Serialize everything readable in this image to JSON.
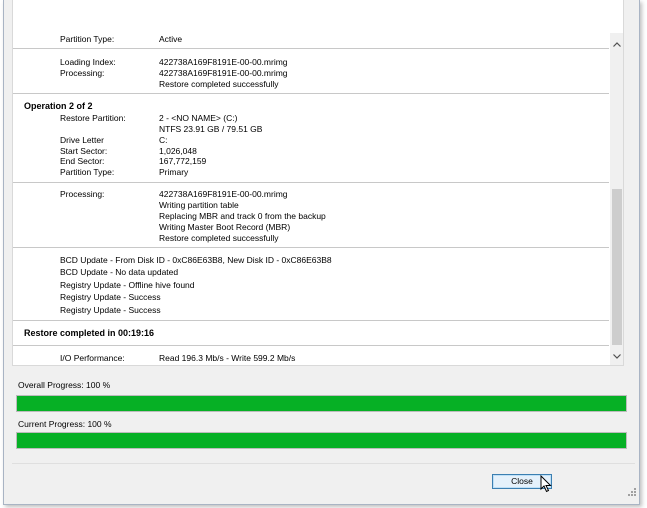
{
  "log": {
    "top_fragment": {
      "label": "Partition Type:",
      "value": "Active"
    },
    "op1_processing": {
      "loading_index_label": "Loading Index:",
      "loading_index_value": "422738A169F8191E-00-00.mrimg",
      "processing_label": "Processing:",
      "processing_lines": [
        "422738A169F8191E-00-00.mrimg",
        "Restore completed successfully"
      ]
    },
    "op2": {
      "heading": "Operation 2 of 2",
      "restore_partition_label": "Restore Partition:",
      "restore_partition_lines": [
        "2 - <NO NAME> (C:)",
        "NTFS 23.91 GB / 79.51 GB"
      ],
      "drive_letter_label": "Drive Letter",
      "drive_letter_value": "C:",
      "start_sector_label": "Start Sector:",
      "start_sector_value": "1,026,048",
      "end_sector_label": "End Sector:",
      "end_sector_value": "167,772,159",
      "partition_type_label": "Partition Type:",
      "partition_type_value": "Primary"
    },
    "op2_processing": {
      "label": "Processing:",
      "lines": [
        "422738A169F8191E-00-00.mrimg",
        "Writing partition table",
        "Replacing MBR and track 0 from the backup",
        "Writing Master Boot Record (MBR)",
        "Restore completed successfully"
      ]
    },
    "bcd_lines": [
      "BCD Update - From Disk ID - 0xC86E63B8,  New Disk ID - 0xC86E63B8",
      "BCD Update - No data updated",
      "Registry Update - Offline hive found",
      "Registry Update - Success",
      "Registry Update - Success"
    ],
    "restore_completed": "Restore completed in 00:19:16",
    "io": {
      "label": "I/O Performance:",
      "value": "Read 196.3 Mb/s - Write 599.2 Mb/s"
    }
  },
  "overall_progress": {
    "label": "Overall Progress:  100 %",
    "percent": 100
  },
  "current_progress": {
    "label": "Current Progress:  100 %",
    "percent": 100
  },
  "close_button": {
    "label": "Close"
  },
  "colors": {
    "progress_fill": "#06b025",
    "track": "#e6e6e6"
  }
}
